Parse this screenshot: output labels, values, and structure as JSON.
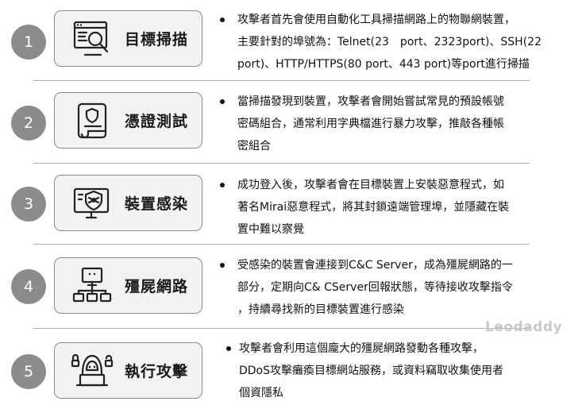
{
  "steps": [
    {
      "number": "1",
      "title": "目標掃描",
      "icon": "scan-icon",
      "lines": [
        "攻擊者首先會使用自動化工具掃描網路上的物聯網裝置，",
        "主要針對的埠號為：Telnet(23　port、2323port)、SSH(22",
        "port)、HTTP/HTTPS(80 port、443 port)等port進行掃描"
      ]
    },
    {
      "number": "2",
      "title": "憑證測試",
      "icon": "credential-scroll-icon",
      "lines": [
        "當掃描發現到裝置，攻擊者會開始嘗試常見的預設帳號",
        "密碼組合，通常利用字典檔進行暴力攻擊，推敲各種帳",
        "密組合"
      ]
    },
    {
      "number": "3",
      "title": "裝置感染",
      "icon": "infected-monitor-icon",
      "lines": [
        "成功登入後，攻擊者會在目標裝置上安裝惡意程式，如",
        "著名Mirai惡意程式，將其封鎖遠端管理埠，並隱藏在裝",
        "置中難以察覺"
      ]
    },
    {
      "number": "4",
      "title": "殭屍網路",
      "icon": "botnet-network-icon",
      "lines": [
        "受感染的裝置會連接到C&C Server，成為殭屍網路的一",
        "部分，定期向C& CServer回報狀態，等待接收攻擊指令",
        "，持續尋找新的目標裝置進行感染"
      ]
    },
    {
      "number": "5",
      "title": "執行攻擊",
      "icon": "hacker-attack-icon",
      "lines": [
        "攻擊者會利用這個龐大的殭屍網路發動各種攻擊，",
        "DDoS攻擊癱瘓目標網站服務，或資料竊取收集使用者",
        "個資隱私"
      ]
    }
  ],
  "watermark": "Leodaddy"
}
